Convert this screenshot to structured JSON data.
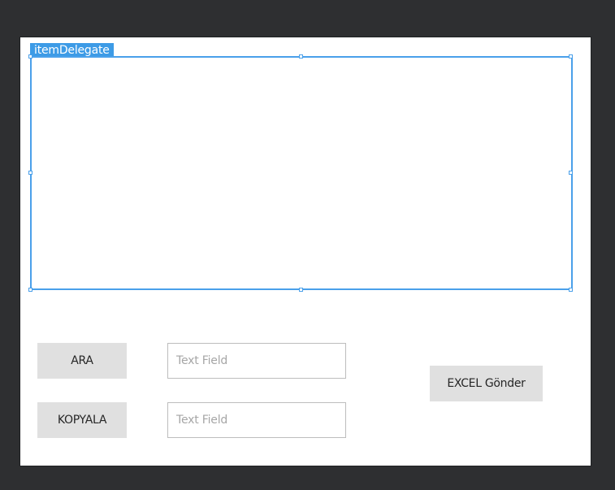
{
  "delegate": {
    "label": "itemDelegate"
  },
  "buttons": {
    "ara": "ARA",
    "kopyala": "KOPYALA",
    "excel": "EXCEL Gönder"
  },
  "fields": [
    {
      "placeholder": "Text Field"
    },
    {
      "placeholder": "Text Field"
    }
  ],
  "colors": {
    "selection": "#4aa0ea",
    "button_bg": "#e0e0e0",
    "backdrop": "#2e2f31"
  }
}
